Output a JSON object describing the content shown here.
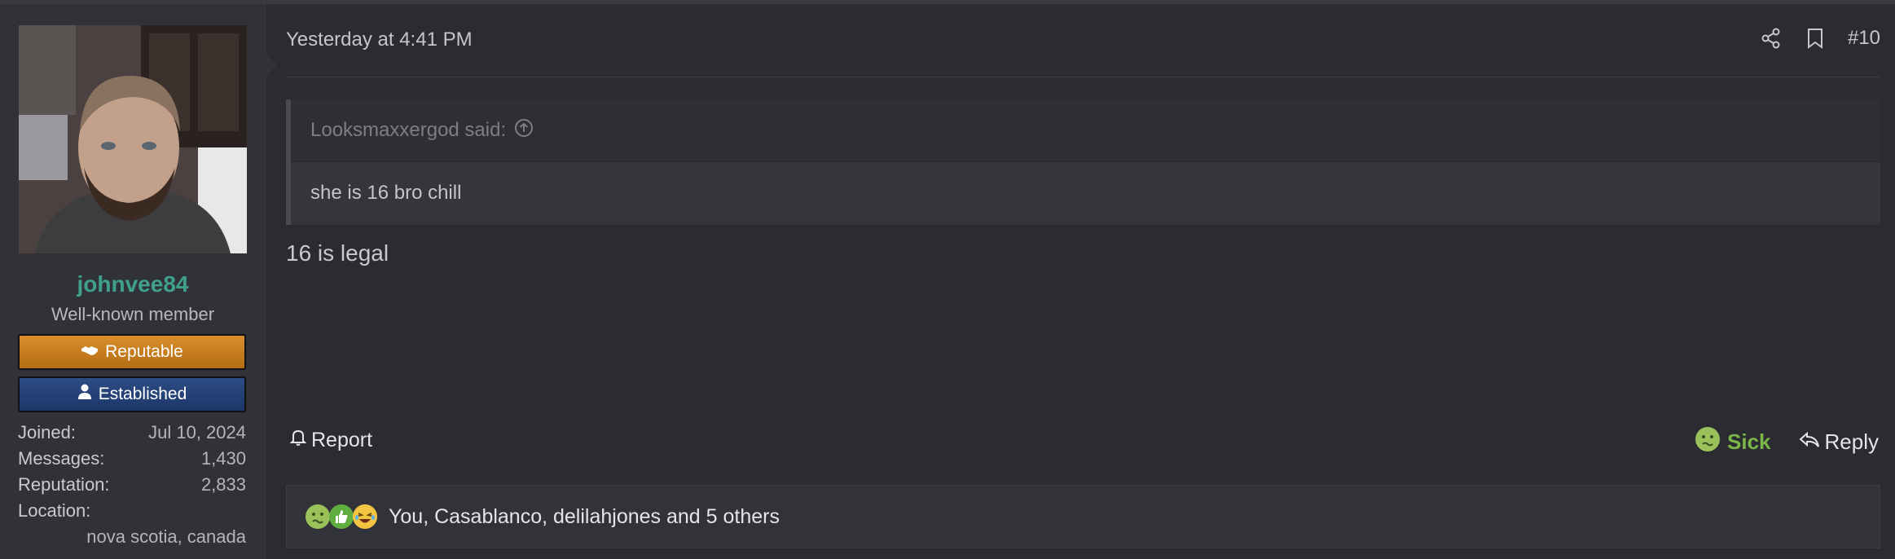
{
  "user": {
    "name": "johnvee84",
    "title": "Well-known member",
    "banners": [
      "Reputable",
      "Established"
    ],
    "stats": [
      {
        "label": "Joined:",
        "value": "Jul 10, 2024"
      },
      {
        "label": "Messages:",
        "value": "1,430"
      },
      {
        "label": "Reputation:",
        "value": "2,833"
      }
    ],
    "location_label": "Location:",
    "location_value": "nova scotia, canada"
  },
  "post": {
    "date": "Yesterday at 4:41 PM",
    "number": "#10",
    "quote_author": "Looksmaxxergod said:",
    "quote_text": "she is 16 bro chill",
    "message": "16 is legal",
    "report_label": "Report",
    "reaction_label": "Sick",
    "reply_label": "Reply",
    "reactions_summary": "You, Casablanco, delilahjones and 5 others"
  },
  "icons": {
    "share": "share-icon",
    "bookmark": "bookmark-icon",
    "quote_arrow": "arrow-up-circle-icon",
    "bell": "bell-icon",
    "reply": "reply-icon",
    "handshake": "handshake-icon",
    "user": "user-icon",
    "sick": "sick-emoji-icon",
    "like": "thumbs-up-icon",
    "laugh": "laugh-emoji-icon"
  },
  "colors": {
    "username": "#3fa08c",
    "reputable_banner": "#c67d1e",
    "established_banner": "#24427a",
    "sick_reaction": "#7ab648"
  }
}
